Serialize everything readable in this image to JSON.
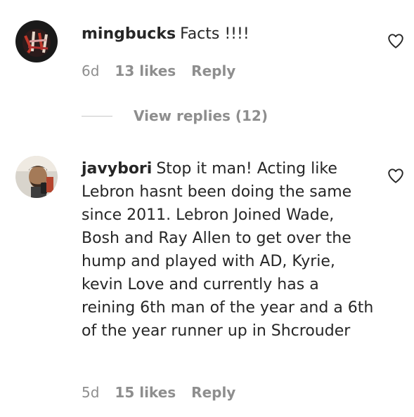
{
  "comments": [
    {
      "username": "mingbucks",
      "text": "Facts !!!!",
      "age": "6d",
      "likes": "13 likes",
      "reply_label": "Reply"
    },
    {
      "username": "javybori",
      "text": "Stop it man! Acting like Lebron hasnt been doing the same since 2011. Lebron Joined Wade, Bosh and Ray Allen to get over the hump and played with AD, Kyrie, kevin Love and currently has a reining 6th man of the year and a 6th of the year runner up in Shcrouder",
      "age": "5d",
      "likes": "15 likes",
      "reply_label": "Reply"
    }
  ],
  "view_replies_label": "View replies (12)",
  "icons": {
    "like": "heart-outline-icon"
  },
  "colors": {
    "text": "#262626",
    "secondary": "#8e8e8e",
    "divider": "#c7c7c7"
  }
}
